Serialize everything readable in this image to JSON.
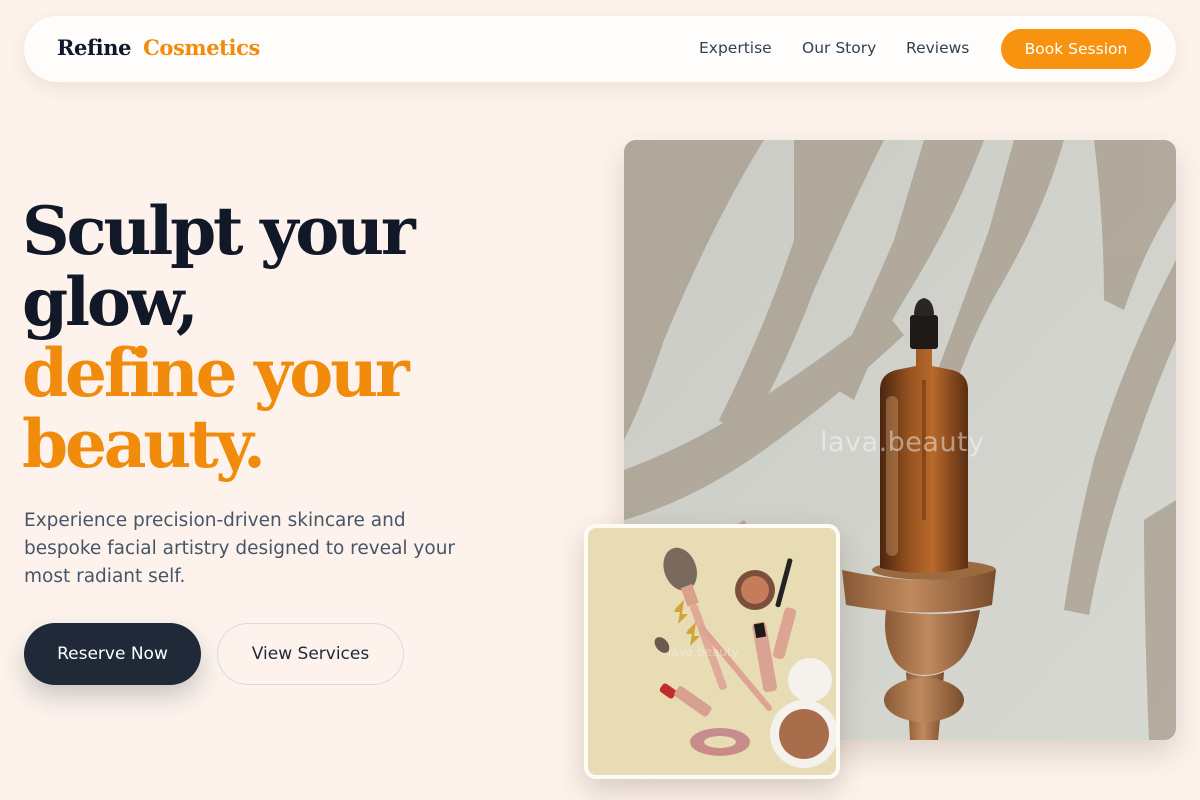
{
  "brand": {
    "part1": "Refine",
    "part2": "Cosmetics"
  },
  "nav": {
    "links": [
      "Expertise",
      "Our Story",
      "Reviews"
    ],
    "cta": "Book Session"
  },
  "hero": {
    "headline_dark": [
      "Sculpt your",
      "glow,"
    ],
    "headline_accent": [
      "define your",
      "beauty."
    ],
    "subtext": "Experience precision-driven skincare and bespoke facial artistry designed to reveal your most radiant self.",
    "primary_button": "Reserve Now",
    "secondary_button": "View Services"
  },
  "images": {
    "main_watermark": "lava.beauty",
    "small_watermark": "lava.beauty"
  },
  "colors": {
    "background": "#fdf3ec",
    "accent": "#f18b0b",
    "dark": "#111827",
    "button_dark": "#1f2937"
  },
  "icons": [
    "dropper-bottle-image",
    "makeup-flatlay-image"
  ]
}
